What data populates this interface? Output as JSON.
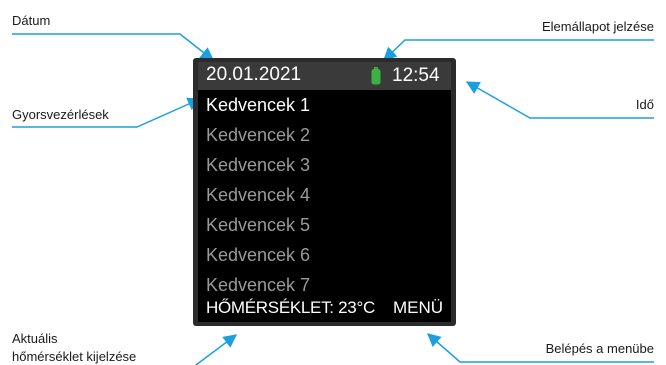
{
  "callouts": {
    "date": "Dátum",
    "battery": "Elemállapot jelzése",
    "quick": "Gyorsvezérlések",
    "time": "Idő",
    "temp_line1": "Aktuális",
    "temp_line2": "hőmérséklet kijelzése",
    "menu": "Belépés a menübe"
  },
  "screen": {
    "date": "20.01.2021",
    "time": "12:54",
    "battery_icon": "battery-icon",
    "favorites": [
      "Kedvencek 1",
      "Kedvencek 2",
      "Kedvencek 3",
      "Kedvencek 4",
      "Kedvencek 5",
      "Kedvencek 6",
      "Kedvencek 7"
    ],
    "temperature": "HŐMÉRSÉKLET: 23°C",
    "menu": "MENÜ"
  },
  "colors": {
    "arrow": "#1aa0e0",
    "battery": "#3cb043",
    "active_text": "#ffffff",
    "inactive_text": "#9a9a9a"
  }
}
